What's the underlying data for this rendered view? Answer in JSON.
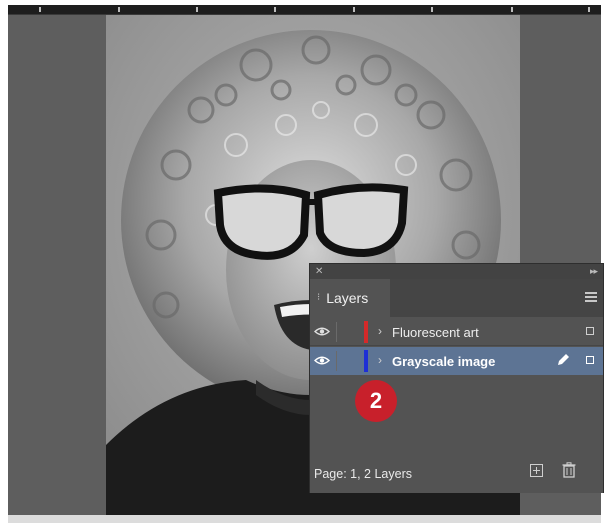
{
  "panel": {
    "title": "Layers",
    "layers": [
      {
        "name": "Fluorescent art",
        "color": "#d42a2a",
        "visible": true,
        "selected": false
      },
      {
        "name": "Grayscale image",
        "color": "#1e2fd6",
        "visible": true,
        "selected": true
      }
    ],
    "footer": {
      "status": "Page: 1, 2 Layers"
    }
  },
  "step_badge": "2",
  "icons": {
    "close": "close-icon",
    "collapse": "double-chevron-icon",
    "menu": "panel-menu-icon",
    "visibility": "eye-icon",
    "edit": "pen-icon",
    "new_layer": "new-layer-icon",
    "delete": "trash-icon"
  }
}
